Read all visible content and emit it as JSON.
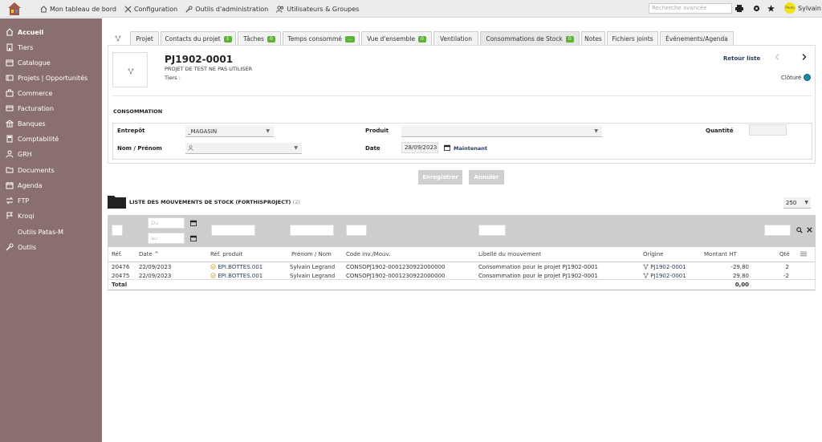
{
  "topbar": {
    "nav": [
      "Mon tableau de bord",
      "Configuration",
      "Outils d'administration",
      "Utilisateurs & Groupes"
    ],
    "search_placeholder": "Recherche avancée",
    "user_name": "Sylvain",
    "avatar_text": "Photo"
  },
  "sidebar": {
    "items": [
      {
        "label": "Accueil",
        "icon": "home-icon"
      },
      {
        "label": "Tiers",
        "icon": "building-icon"
      },
      {
        "label": "Catalogue",
        "icon": "cube-icon"
      },
      {
        "label": "Projets | Opportunités",
        "icon": "project-icon"
      },
      {
        "label": "Commerce",
        "icon": "suitcase-icon"
      },
      {
        "label": "Facturation",
        "icon": "invoice-icon"
      },
      {
        "label": "Banques",
        "icon": "bank-icon"
      },
      {
        "label": "Comptabilité",
        "icon": "calculator-icon"
      },
      {
        "label": "GRH",
        "icon": "users-icon"
      },
      {
        "label": "Documents",
        "icon": "folder-icon"
      },
      {
        "label": "Agenda",
        "icon": "calendar-icon"
      },
      {
        "label": "FTP",
        "icon": "transfer-icon"
      },
      {
        "label": "Kroqi",
        "icon": "flag-icon"
      },
      {
        "label": "Outils Patas-M",
        "icon": ""
      },
      {
        "label": "Outils",
        "icon": "wrench-icon"
      }
    ]
  },
  "tabs": [
    {
      "label": "Projet"
    },
    {
      "label": "Contacts du projet",
      "badge": "1"
    },
    {
      "label": "Tâches",
      "badge": "0"
    },
    {
      "label": "Temps consommé",
      "badge": "..."
    },
    {
      "label": "Vue d'ensemble",
      "badge": "0"
    },
    {
      "label": "Ventilation"
    },
    {
      "label": "Consommations de Stock",
      "badge": "0"
    },
    {
      "label": "Notes"
    },
    {
      "label": "Fichiers joints"
    },
    {
      "label": "Événements/Agenda"
    }
  ],
  "project": {
    "ref": "PJ1902-0001",
    "label": "PROJET DE TEST NE PAS UTILISER",
    "tiers_label": "Tiers :",
    "retour": "Retour liste",
    "status": "Clôturé"
  },
  "conso": {
    "title": "CONSOMMATION",
    "entrepot_label": "Entrepôt",
    "entrepot_value": "_MAGASIN",
    "produit_label": "Produit",
    "quantite_label": "Quantité",
    "nom_label": "Nom / Prénom",
    "date_label": "Date",
    "date_value": "28/09/2023",
    "maintenant": "Maintenant"
  },
  "buttons": {
    "save": "Enregistrer",
    "cancel": "Annuler"
  },
  "list": {
    "title": "LISTE DES MOUVEMENTS DE STOCK (FORTHISPROJECT)",
    "count": "(2)",
    "limit": "250",
    "date_from_placeholder": "Du",
    "date_to_placeholder": "au",
    "columns": [
      "Réf.",
      "Date",
      "Réf. produit",
      "Prénom / Nom",
      "Code inv./Mouv.",
      "Libellé du mouvement",
      "Origine",
      "Montant HT",
      "Qté"
    ],
    "rows": [
      {
        "ref": "20476",
        "date": "22/09/2023",
        "product": "EPI.BOTTES.001",
        "person": "Sylvain Legrand",
        "code": "CONSOPJ1902-0001230922000000",
        "libelle": "Consommation pour le projet PJ1902-0001",
        "origine": "PJ1902-0001",
        "montant": "-29,80",
        "qte": "2"
      },
      {
        "ref": "20475",
        "date": "22/09/2023",
        "product": "EPI.BOTTES.001",
        "person": "Sylvain Legrand",
        "code": "CONSOPJ1902-0001230922000000",
        "libelle": "Consommation pour le projet PJ1902-0001",
        "origine": "PJ1902-0001",
        "montant": "29,80",
        "qte": "-2"
      }
    ],
    "total_label": "Total",
    "total_value": "0,00"
  }
}
